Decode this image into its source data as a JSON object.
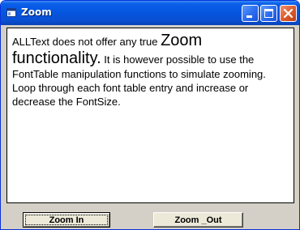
{
  "window": {
    "title": "Zoom",
    "icon": "form-icon",
    "controls": {
      "minimize_icon": "minimize-icon",
      "maximize_icon": "maximize-icon",
      "close_icon": "close-icon"
    }
  },
  "textbox": {
    "segments": [
      "ALLText does not offer any true ",
      "Zoom functionality.",
      "   It is however possible to use the FontTable manipulation functions to simulate zooming.   Loop through each font table entry and increase or decrease the FontSize."
    ]
  },
  "buttons": {
    "zoom_in_label": "Zoom In",
    "zoom_out_label": "Zoom _Out"
  },
  "colors": {
    "titlebar": "#0a5fe8",
    "window_face": "#d4d0c8",
    "close_button": "#dc5a2a"
  }
}
